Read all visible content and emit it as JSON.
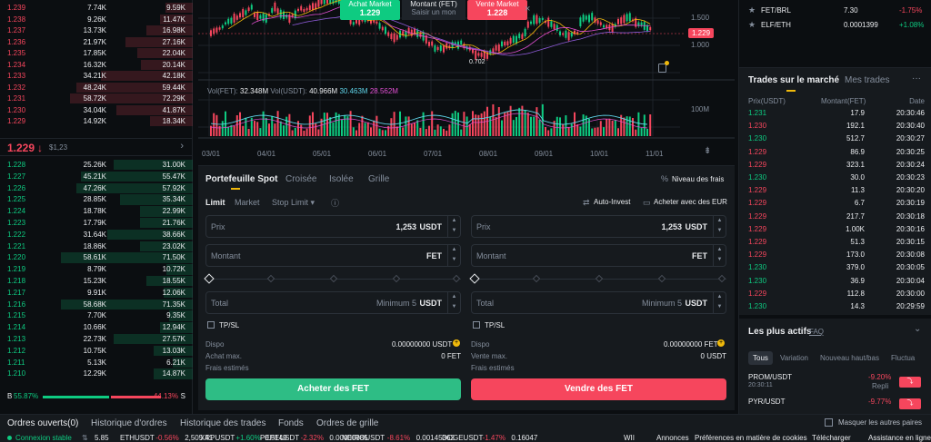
{
  "orderbook": {
    "asks": [
      [
        "1.239",
        "7.74K",
        "9.59K"
      ],
      [
        "1.238",
        "9.26K",
        "11.47K"
      ],
      [
        "1.237",
        "13.73K",
        "16.98K"
      ],
      [
        "1.236",
        "21.97K",
        "27.16K"
      ],
      [
        "1.235",
        "17.85K",
        "22.04K"
      ],
      [
        "1.234",
        "16.32K",
        "20.14K"
      ],
      [
        "1.233",
        "34.21K",
        "42.18K"
      ],
      [
        "1.232",
        "48.24K",
        "59.44K"
      ],
      [
        "1.231",
        "58.72K",
        "72.29K"
      ],
      [
        "1.230",
        "34.04K",
        "41.87K"
      ],
      [
        "1.229",
        "14.92K",
        "18.34K"
      ]
    ],
    "ask_fill": [
      0.22,
      0.27,
      0.38,
      0.55,
      0.45,
      0.42,
      0.75,
      0.95,
      1.0,
      0.62,
      0.35
    ],
    "mid_price": "1.229",
    "mid_arrow": "↓",
    "mid_usd": "$1,23",
    "mid_chevron": "›",
    "bids": [
      [
        "1.228",
        "25.26K",
        "31.00K"
      ],
      [
        "1.227",
        "45.21K",
        "55.47K"
      ],
      [
        "1.226",
        "47.26K",
        "57.92K"
      ],
      [
        "1.225",
        "28.85K",
        "35.34K"
      ],
      [
        "1.224",
        "18.78K",
        "22.99K"
      ],
      [
        "1.223",
        "17.79K",
        "21.76K"
      ],
      [
        "1.222",
        "31.64K",
        "38.66K"
      ],
      [
        "1.221",
        "18.86K",
        "23.02K"
      ],
      [
        "1.220",
        "58.61K",
        "71.50K"
      ],
      [
        "1.219",
        "8.79K",
        "10.72K"
      ],
      [
        "1.218",
        "15.23K",
        "18.55K"
      ],
      [
        "1.217",
        "9.91K",
        "12.06K"
      ],
      [
        "1.216",
        "58.68K",
        "71.35K"
      ],
      [
        "1.215",
        "7.70K",
        "9.35K"
      ],
      [
        "1.214",
        "10.66K",
        "12.94K"
      ],
      [
        "1.213",
        "22.73K",
        "27.57K"
      ],
      [
        "1.212",
        "10.75K",
        "13.03K"
      ],
      [
        "1.211",
        "5.13K",
        "6.21K"
      ],
      [
        "1.210",
        "12.29K",
        "14.87K"
      ]
    ],
    "bid_fill": [
      0.6,
      0.85,
      0.88,
      0.55,
      0.4,
      0.4,
      0.65,
      0.4,
      1.0,
      0.2,
      0.35,
      0.22,
      1.0,
      0.18,
      0.25,
      0.6,
      0.3,
      0.15,
      0.3
    ],
    "buy_label": "B",
    "buy_pct": "55.87%",
    "buy_ratio": 0.5587,
    "sell_pct": "44.13%",
    "sell_label": "S"
  },
  "chart": {
    "order_widget": {
      "buy_label": "Achat Market",
      "buy_price": "1.229",
      "amount_label": "Montant (FET)",
      "amount_placeholder": "Saisir un mon",
      "sell_label": "Vente Market",
      "sell_price": "1.228",
      "close": "×"
    },
    "price_ticks": [
      "1.500",
      "1.000"
    ],
    "current_price": "1.229",
    "low_label": "0.702",
    "vol_label": "Vol(FET):",
    "vol_fet": "32.348M",
    "vol_usdt_label": "Vol(USDT):",
    "vol_usdt": "40.966M",
    "vol_ma1": "30.463M",
    "vol_ma2": "28.562M",
    "vol_tick": "100M",
    "x_labels": [
      "03/01",
      "04/01",
      "05/01",
      "06/01",
      "07/01",
      "08/01",
      "09/01",
      "10/01",
      "11/01"
    ],
    "colors": {
      "up": "#0ecb81",
      "down": "#f6465d",
      "ma1": "#f0b90b",
      "ma2": "#e04fd2",
      "ma3": "#8d5ad6",
      "vol_ma": "#5fd3e8"
    }
  },
  "trade": {
    "tabs": [
      "Portefeuille Spot",
      "Croisée",
      "Isolée",
      "Grille"
    ],
    "fees": "Niveau des frais",
    "order_types": [
      "Limit",
      "Market",
      "Stop Limit ▾"
    ],
    "auto_invest": "Auto-Invest",
    "buy_with": "Acheter avec des EUR",
    "buy": {
      "price_label": "Prix",
      "price": "1,253",
      "price_unit": "USDT",
      "amount_label": "Montant",
      "amount_unit": "FET",
      "total_label": "Total",
      "total_min": "Minimum 5",
      "total_unit": "USDT",
      "tpsl": "TP/SL",
      "dispo_label": "Dispo",
      "dispo": "0.00000000 USDT",
      "max_label": "Achat max.",
      "max": "0 FET",
      "fees_label": "Frais estimés",
      "button": "Acheter des FET"
    },
    "sell": {
      "price_label": "Prix",
      "price": "1,253",
      "price_unit": "USDT",
      "amount_label": "Montant",
      "amount_unit": "FET",
      "total_label": "Total",
      "total_min": "Minimum 5",
      "total_unit": "USDT",
      "tpsl": "TP/SL",
      "dispo_label": "Dispo",
      "dispo": "0.00000000 FET",
      "max_label": "Vente max.",
      "max": "0 USDT",
      "fees_label": "Frais estimés",
      "button": "Vendre des FET"
    }
  },
  "market": {
    "pairs": [
      [
        "FET/BRL",
        "7.30",
        "-1.75%"
      ],
      [
        "ELF/ETH",
        "0.0001399",
        "+1.08%"
      ]
    ],
    "tabs": [
      "Trades sur le marché",
      "Mes trades"
    ],
    "more": "···",
    "cols": [
      "Prix(USDT)",
      "Montant(FET)",
      "Date"
    ],
    "trades": [
      [
        "1.231",
        "17.9",
        "20:30:46",
        "g"
      ],
      [
        "1.230",
        "192.1",
        "20:30:40",
        "r"
      ],
      [
        "1.230",
        "512.7",
        "20:30:27",
        "g"
      ],
      [
        "1.229",
        "86.9",
        "20:30:25",
        "r"
      ],
      [
        "1.229",
        "323.1",
        "20:30:24",
        "r"
      ],
      [
        "1.230",
        "30.0",
        "20:30:23",
        "g"
      ],
      [
        "1.229",
        "11.3",
        "20:30:20",
        "r"
      ],
      [
        "1.229",
        "6.7",
        "20:30:19",
        "r"
      ],
      [
        "1.229",
        "217.7",
        "20:30:18",
        "r"
      ],
      [
        "1.229",
        "1.00K",
        "20:30:16",
        "r"
      ],
      [
        "1.229",
        "51.3",
        "20:30:15",
        "r"
      ],
      [
        "1.229",
        "173.0",
        "20:30:08",
        "r"
      ],
      [
        "1.230",
        "379.0",
        "20:30:05",
        "g"
      ],
      [
        "1.230",
        "36.9",
        "20:30:04",
        "g"
      ],
      [
        "1.229",
        "112.8",
        "20:30:00",
        "r"
      ],
      [
        "1.230",
        "14.3",
        "20:29:59",
        "g"
      ]
    ],
    "actifs_title": "Les plus actifs",
    "faq": "FAQ",
    "actifs_tabs": [
      "Tous",
      "Variation",
      "Nouveau haut/bas",
      "Fluctua"
    ],
    "actifs": [
      [
        "PROM/USDT",
        "20:30:11",
        "-9.20%",
        "Repli"
      ],
      [
        "PYR/USDT",
        "",
        "-9.77%",
        ""
      ]
    ]
  },
  "bottom": {
    "tabs": [
      "Ordres ouverts(0)",
      "Historique d'ordres",
      "Historique des trades",
      "Fonds",
      "Ordres de grille"
    ],
    "hide_others": "Masquer les autres paires",
    "status": "Connexion stable",
    "tickers": [
      [
        "5.85",
        "",
        ""
      ],
      [
        "ETHUSDT",
        "-0.56%",
        "2,505.41"
      ],
      [
        "XRPUSDT",
        "+1.60%",
        "0.5149"
      ],
      [
        "PEPEUSDT",
        "-2.32%",
        "0.00000885"
      ],
      [
        "NEIROUSDT",
        "-8.61%",
        "0.00145362"
      ],
      [
        "DOGEUSDT",
        "-1.47%",
        "0.16047"
      ],
      [
        "WII",
        "",
        ""
      ]
    ],
    "links": [
      "Annonces",
      "Préférences en matière de cookies",
      "Télécharger",
      "Assistance en ligne"
    ]
  }
}
